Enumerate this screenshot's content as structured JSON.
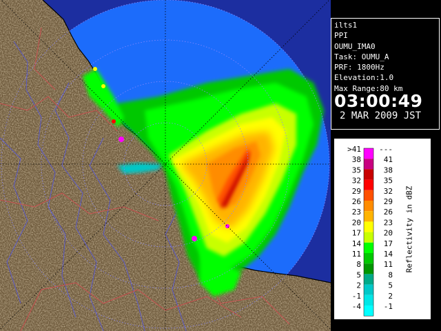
{
  "radar": {
    "image_label": "PPI reflectivity display",
    "colors": {
      "range_fill": "#1c6cfb",
      "background": "#1c2ea0",
      "land": "#6e5a3c",
      "coast": "#000000",
      "rivers": "#5a5ac8",
      "borders": "#c85050",
      "rings": "#8888ff"
    }
  },
  "info": {
    "site": "ilts1",
    "product": "PPI",
    "dataset": "OUMU_IMA0",
    "task": "Task: OUMU_A",
    "prf": "PRF: 1800Hz",
    "elevation": "Elevation:1.0",
    "max_range": "Max Range:80 km",
    "time": "03:00:49",
    "date": "2 MAR 2009 JST"
  },
  "legend": {
    "title": "Reflectivity in dBZ",
    "bins": [
      {
        "low": ">41",
        "high": "---",
        "color": "#ff00ff"
      },
      {
        "low": "38",
        "high": "41",
        "color": "#c80080"
      },
      {
        "low": "35",
        "high": "38",
        "color": "#c80000"
      },
      {
        "low": "32",
        "high": "35",
        "color": "#ff0000"
      },
      {
        "low": "29",
        "high": "32",
        "color": "#ff5000"
      },
      {
        "low": "26",
        "high": "29",
        "color": "#ff8c00"
      },
      {
        "low": "23",
        "high": "26",
        "color": "#ffb400"
      },
      {
        "low": "20",
        "high": "23",
        "color": "#ffff00"
      },
      {
        "low": "17",
        "high": "20",
        "color": "#c8ff00"
      },
      {
        "low": "14",
        "high": "17",
        "color": "#00ff00"
      },
      {
        "low": "11",
        "high": "14",
        "color": "#00c800"
      },
      {
        "low": "8",
        "high": "11",
        "color": "#009600"
      },
      {
        "low": "5",
        "high": "8",
        "color": "#00aa88"
      },
      {
        "low": "2",
        "high": "5",
        "color": "#00c8c8"
      },
      {
        "low": "-1",
        "high": "2",
        "color": "#00e6e6"
      },
      {
        "low": "-4",
        "high": "-1",
        "color": "#00ffff"
      }
    ]
  }
}
